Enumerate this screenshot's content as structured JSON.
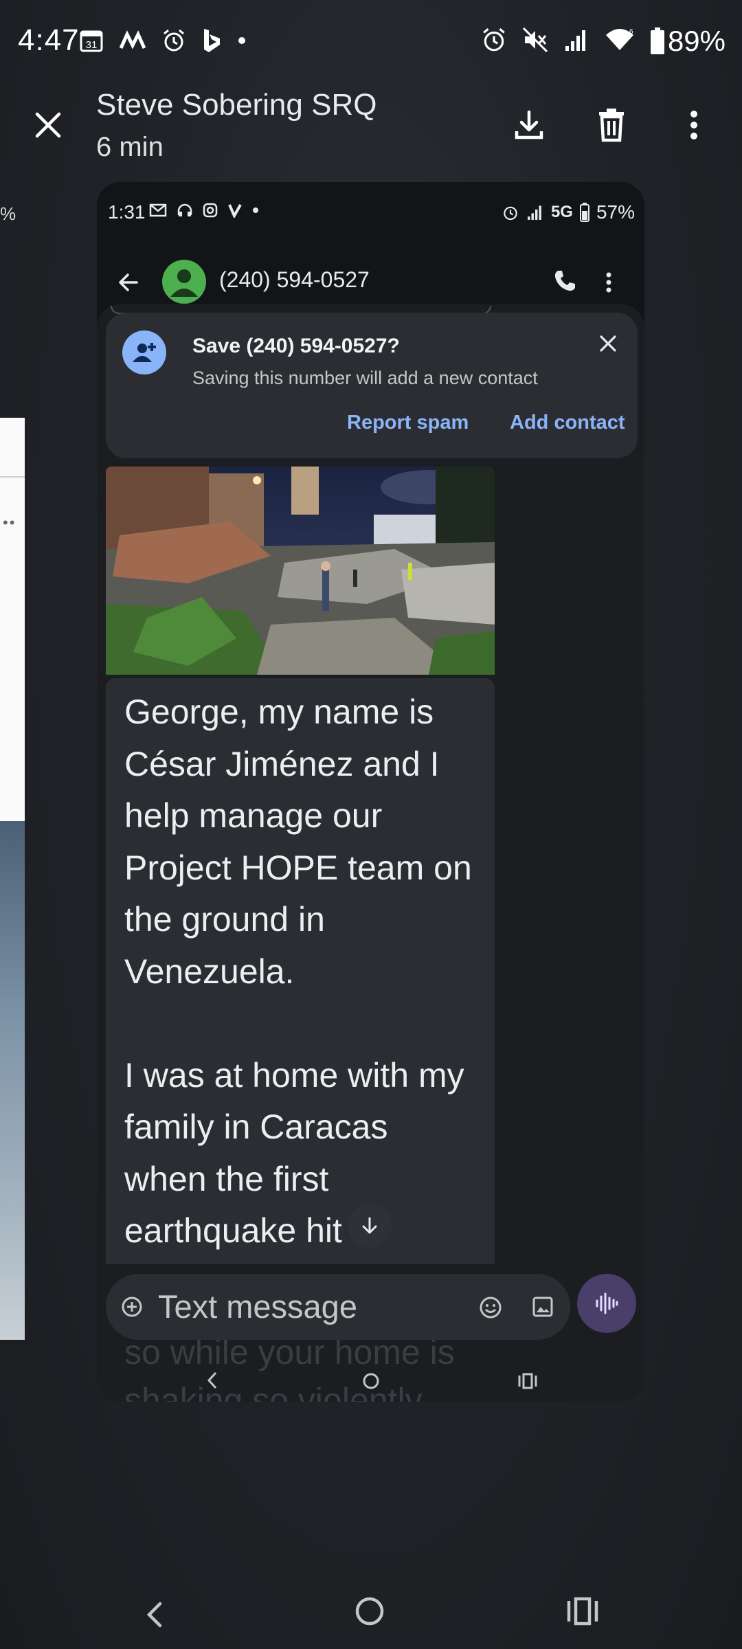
{
  "status_bar": {
    "time": "4:47",
    "calendar_day": "31",
    "battery": "89%",
    "icons": [
      "calendar-icon",
      "m-app-icon",
      "alarm-icon",
      "bing-icon",
      "dot-icon",
      "alarm-icon",
      "mute-icon",
      "signal-icon",
      "wifi-icon",
      "battery-icon"
    ]
  },
  "viewer": {
    "sender": "Steve Sobering SRQ",
    "age": "6 min",
    "actions": [
      "download-icon",
      "delete-icon",
      "more-vert-icon"
    ]
  },
  "peek": {
    "label": "%"
  },
  "inner": {
    "status": {
      "time": "1:31",
      "network": "5G",
      "battery": "57%"
    },
    "appbar": {
      "phone": "(240) 594-0527"
    },
    "save_card": {
      "title": "Save (240) 594-0527?",
      "subtitle": "Saving this number will add a new contact",
      "report_spam": "Report spam",
      "add_contact": "Add contact"
    },
    "message": {
      "text": "George, my name is\nCésar Jiménez and I\nhelp manage our\nProject HOPE team on\nthe ground in\nVenezuela.\n\nI was at home with my\nfamily in Caracas\nwhen the first\nearthquake hit",
      "below_compose": "so while your home is\nshaking so violently"
    },
    "compose": {
      "placeholder": "Text message"
    }
  }
}
